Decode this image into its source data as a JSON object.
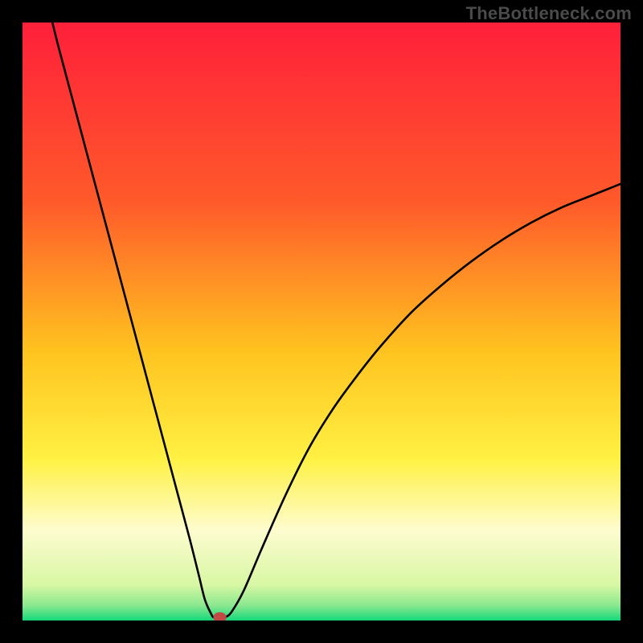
{
  "watermark": "TheBottleneck.com",
  "chart_data": {
    "type": "line",
    "title": "",
    "xlabel": "",
    "ylabel": "",
    "xlim": [
      0,
      100
    ],
    "ylim": [
      0,
      100
    ],
    "grid": false,
    "legend": false,
    "annotations": [],
    "background_gradient_stops": [
      {
        "offset": 0.0,
        "color": "#ff1f3a"
      },
      {
        "offset": 0.3,
        "color": "#ff5a2a"
      },
      {
        "offset": 0.55,
        "color": "#ffc31f"
      },
      {
        "offset": 0.73,
        "color": "#fff143"
      },
      {
        "offset": 0.85,
        "color": "#fdfccf"
      },
      {
        "offset": 0.94,
        "color": "#d8f7a4"
      },
      {
        "offset": 0.975,
        "color": "#8ae88f"
      },
      {
        "offset": 1.0,
        "color": "#15d87a"
      }
    ],
    "series": [
      {
        "name": "bottleneck-curve",
        "x": [
          5,
          6,
          8,
          10,
          12,
          14,
          16,
          18,
          20,
          22,
          24,
          26,
          28,
          29.5,
          30.5,
          31.5,
          32,
          33,
          34,
          35,
          37,
          40,
          44,
          48,
          52,
          56,
          60,
          65,
          70,
          75,
          80,
          85,
          90,
          95,
          100
        ],
        "y": [
          100,
          96,
          88.5,
          81,
          73.5,
          66,
          58.5,
          51,
          43.5,
          36,
          28.5,
          21,
          13.5,
          7.5,
          3.5,
          1.2,
          0.5,
          0.5,
          0.6,
          1.5,
          5,
          12,
          21,
          29,
          35.5,
          41,
          46,
          51.5,
          56,
          60,
          63.5,
          66.5,
          69,
          71,
          73
        ]
      }
    ],
    "marker": {
      "name": "bottleneck-point",
      "x": 33,
      "y": 0.5,
      "rx": 1.1,
      "ry": 0.9,
      "color": "#c24a45"
    }
  }
}
